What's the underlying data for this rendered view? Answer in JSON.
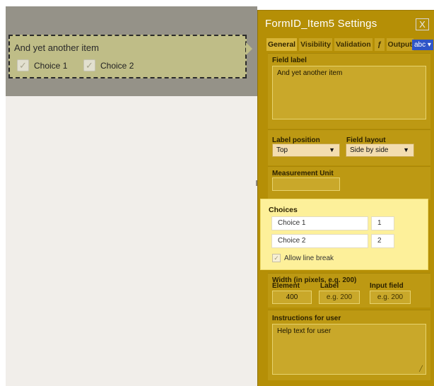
{
  "form_item": {
    "label": "And yet another item",
    "choices": [
      {
        "label": "Choice 1",
        "checked": true
      },
      {
        "label": "Choice 2",
        "checked": true
      }
    ]
  },
  "panel": {
    "title": "FormID_Item5 Settings",
    "close_glyph": "X",
    "tabs": [
      "General",
      "Visibility",
      "Validation",
      "ƒ",
      "Output"
    ],
    "active_tab": "General",
    "format_select": "abc ▾",
    "field_label": {
      "label": "Field label",
      "value": "And yet another item"
    },
    "label_position": {
      "label": "Label position",
      "value": "Top"
    },
    "field_layout": {
      "label": "Field layout",
      "value": "Side by side"
    },
    "measurement_unit": {
      "label": "Measurement Unit",
      "value": ""
    },
    "choices": {
      "label": "Choices",
      "items": [
        {
          "text": "Choice 1",
          "value": "1"
        },
        {
          "text": "Choice 2",
          "value": "2"
        }
      ],
      "allow_line_break": {
        "label": "Allow line break",
        "checked": true
      }
    },
    "width": {
      "label": "Width (in pixels, e.g. 200)",
      "element_label": "Element",
      "label_label": "Label",
      "input_label": "Input field",
      "element_value": "400",
      "label_placeholder": "e.g. 200",
      "input_placeholder": "e.g. 200"
    },
    "instructions": {
      "label": "Instructions for user",
      "placeholder": "Help text for user"
    }
  },
  "colors": {
    "panel_bg": "#b58f06",
    "form_item_bg": "#bfbd87",
    "choices_highlight": "#fdf09a",
    "canvas_bg": "#f1eeea",
    "abc_select": "#2e55c7"
  }
}
